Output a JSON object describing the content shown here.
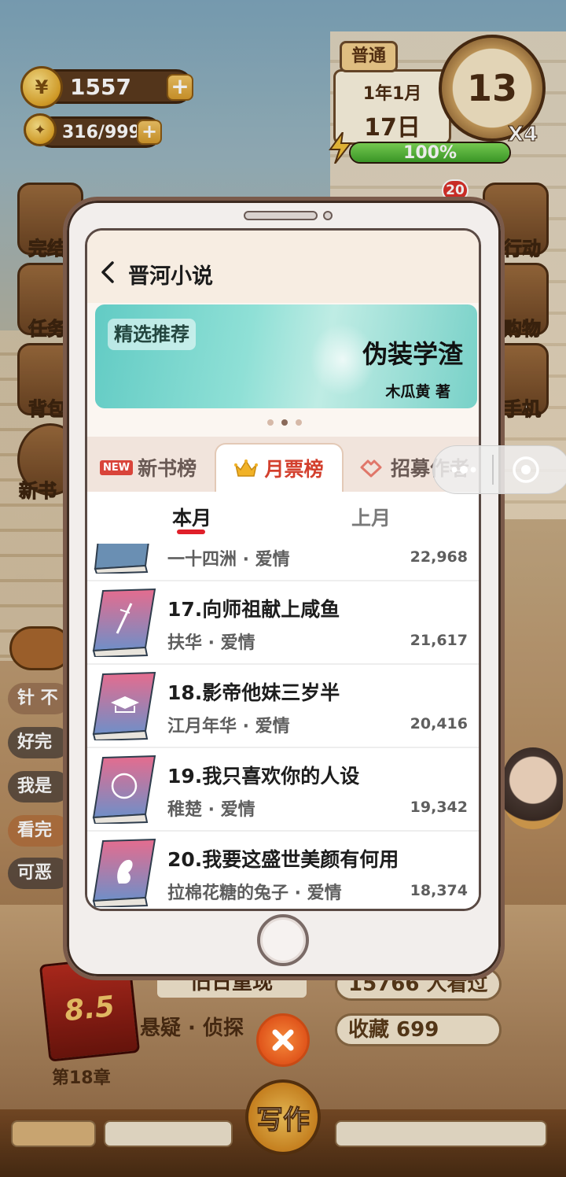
{
  "hud": {
    "coins": "1557",
    "energy": "316/999",
    "mode": "普通",
    "date_year_month": "1年1月",
    "date_day": "17日",
    "clock_value": "13",
    "speed": "X4",
    "stamina_percent": "100%",
    "stamina_fraction": 1.0,
    "notification_count": "20"
  },
  "side_menu": {
    "left": [
      "完结",
      "任务",
      "背包",
      "新书"
    ],
    "right": [
      "行动",
      "购物",
      "手机"
    ]
  },
  "chat": [
    "针 不",
    "好完",
    "我是",
    "看完",
    "可恶"
  ],
  "bottom": {
    "book_rating": "8.5",
    "chapter": "第18章",
    "book_name": "旧日重现",
    "genre": "悬疑 · 侦探",
    "readers": "15766  人看过",
    "favorites": "收藏  699",
    "write_label": "写作"
  },
  "phone": {
    "app_title": "晋河小说",
    "banner": {
      "tag": "精选推荐",
      "book_title": "伪装学渣",
      "author": "木瓜黄  著"
    },
    "tabs": {
      "new_badge": "NEW",
      "new_books": "新书榜",
      "monthly_votes": "月票榜",
      "recruit": "招募作者"
    },
    "subtabs": {
      "this_month": "本月",
      "last_month": "上月"
    },
    "ranking": [
      {
        "title": "",
        "author_genre": "一十四洲 · 爱情",
        "votes": "22,968"
      },
      {
        "title": "17.向师祖献上咸鱼",
        "author_genre": "扶华 · 爱情",
        "votes": "21,617"
      },
      {
        "title": "18.影帝他妹三岁半",
        "author_genre": "江月年华 · 爱情",
        "votes": "20,416"
      },
      {
        "title": "19.我只喜欢你的人设",
        "author_genre": "稚楚 · 爱情",
        "votes": "19,342"
      },
      {
        "title": "20.我要这盛世美颜有何用",
        "author_genre": "拉棉花糖的兔子 · 爱情",
        "votes": "18,374"
      }
    ]
  },
  "colors": {
    "accent_red": "#d3402e",
    "banner_teal": "#62cbc4",
    "energy_green": "#3fa22a"
  }
}
